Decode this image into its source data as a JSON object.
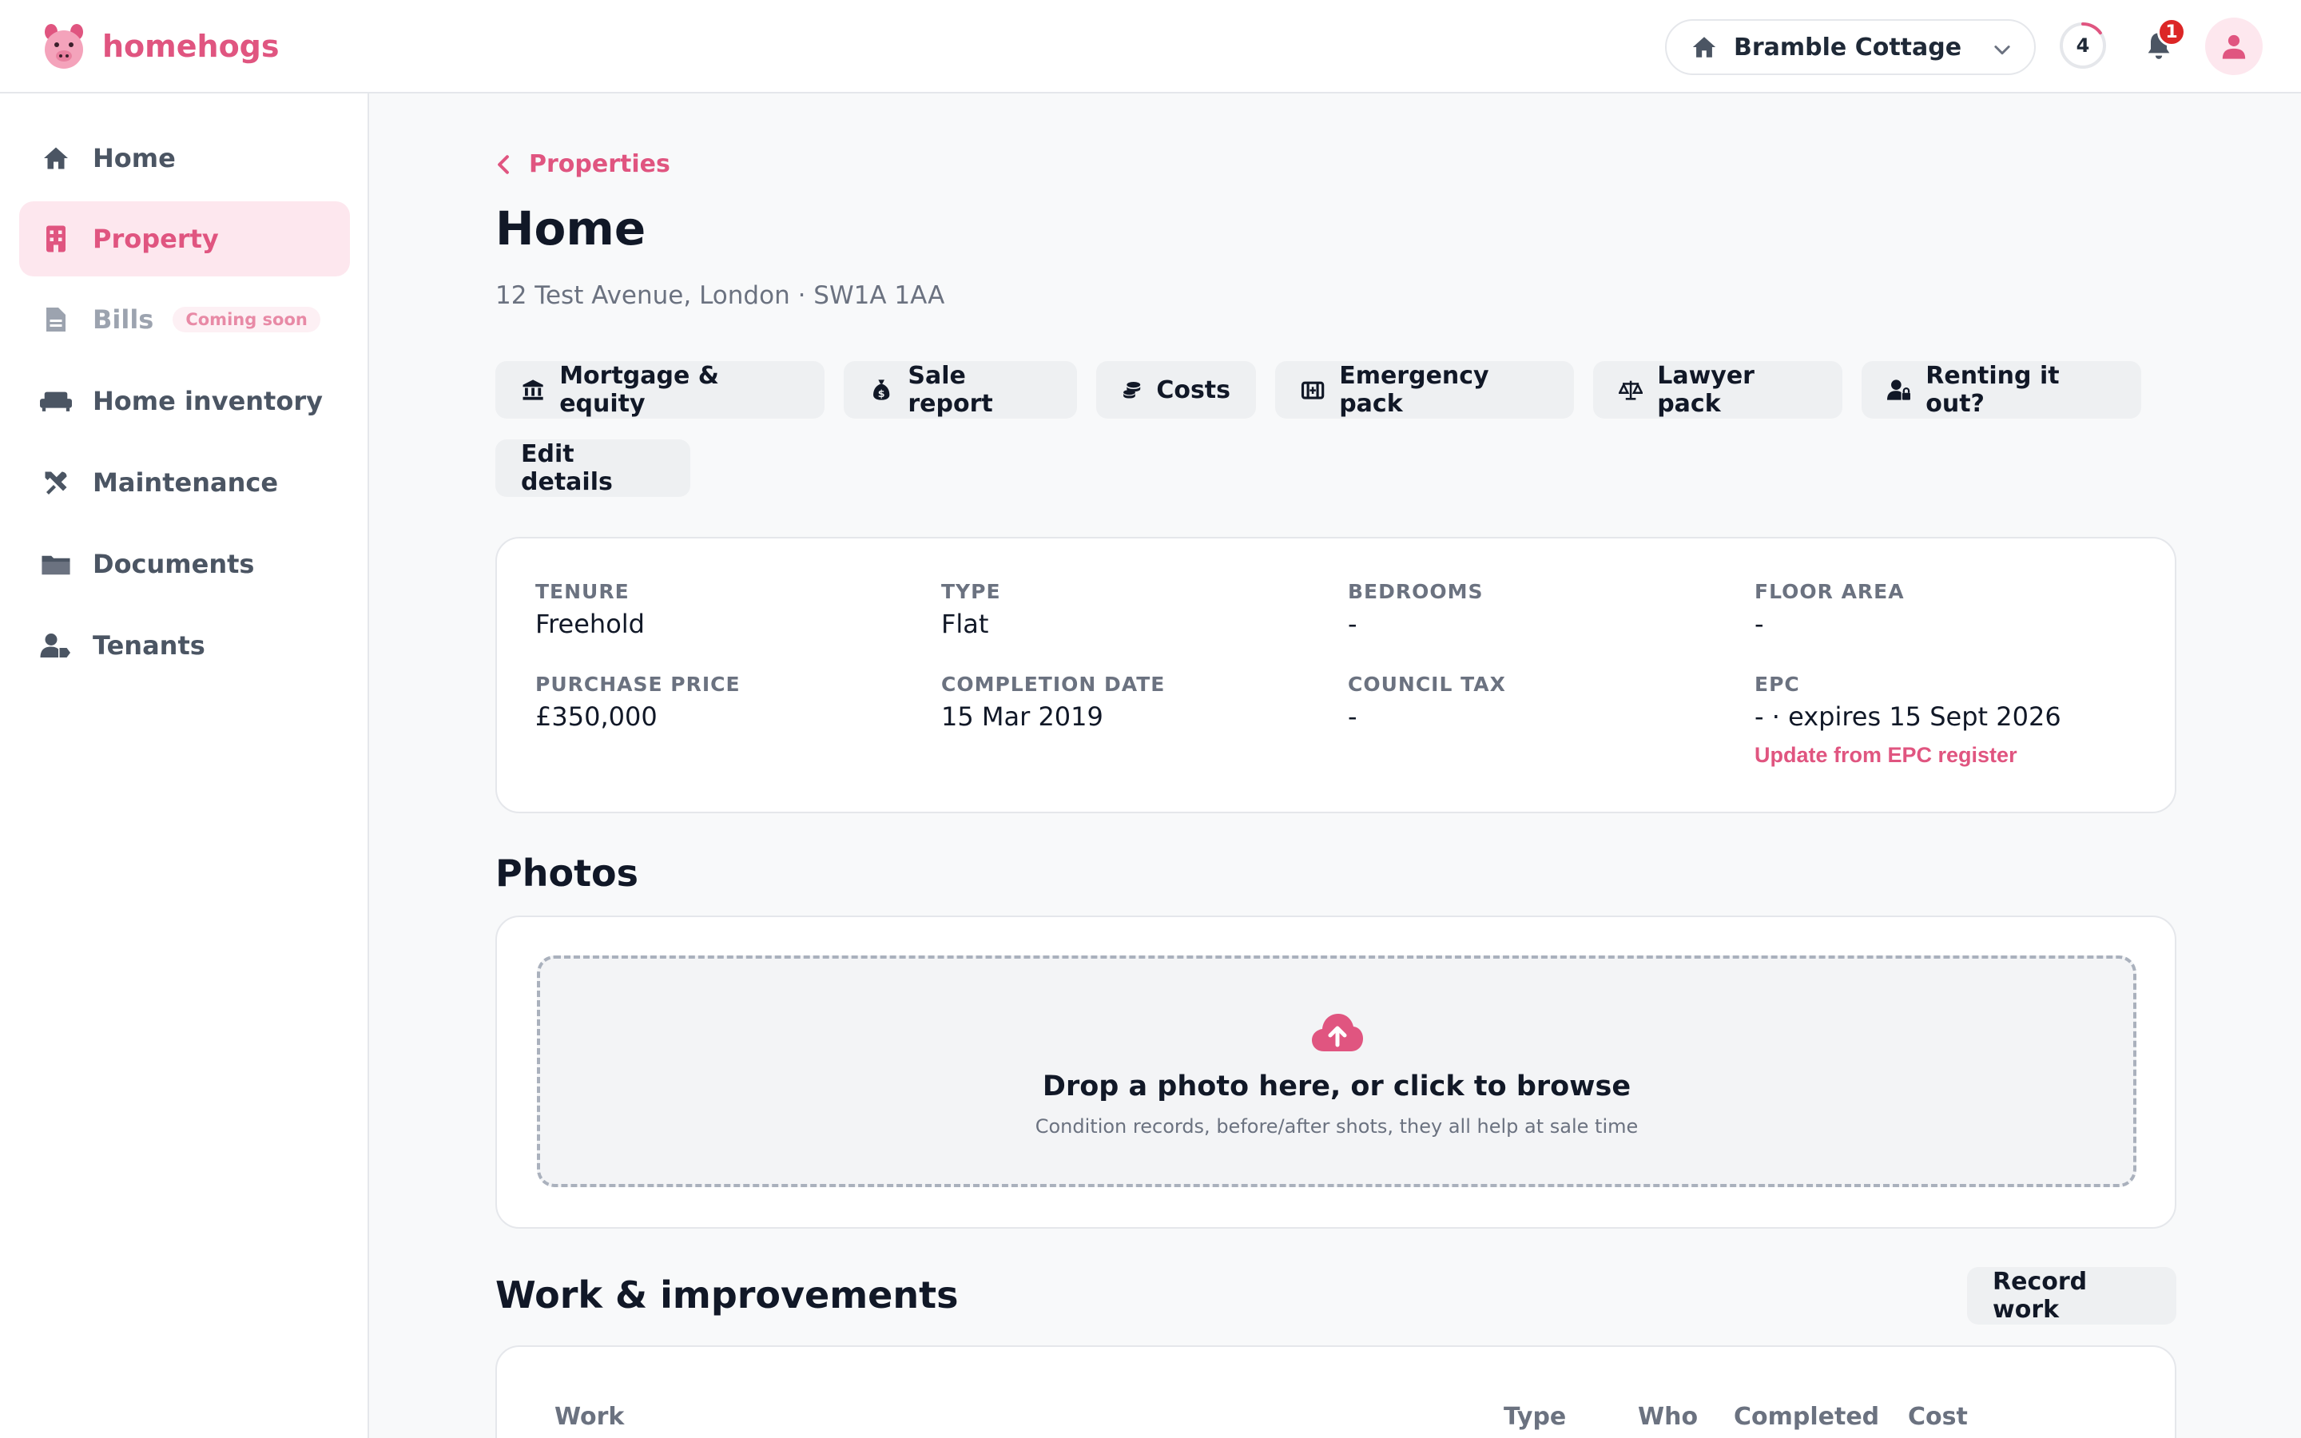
{
  "app": {
    "name": "homehogs"
  },
  "header": {
    "property_selector": "Bramble Cottage",
    "progress_count": "4",
    "progress_fraction": 0.15,
    "notifications_count": "1"
  },
  "sidebar": {
    "items": [
      {
        "label": "Home",
        "icon": "home-icon"
      },
      {
        "label": "Property",
        "icon": "building-icon",
        "active": true
      },
      {
        "label": "Bills",
        "icon": "document-icon",
        "badge": "Coming soon",
        "disabled": true
      },
      {
        "label": "Home inventory",
        "icon": "couch-icon"
      },
      {
        "label": "Maintenance",
        "icon": "tools-icon"
      },
      {
        "label": "Documents",
        "icon": "folder-icon"
      },
      {
        "label": "Tenants",
        "icon": "user-tag-icon"
      }
    ]
  },
  "main": {
    "breadcrumb": "Properties",
    "title": "Home",
    "address": "12 Test Avenue, London · SW1A 1AA",
    "actions": [
      {
        "label": "Mortgage & equity",
        "icon": "bank-icon"
      },
      {
        "label": "Sale report",
        "icon": "money-bag-icon"
      },
      {
        "label": "Costs",
        "icon": "coins-icon"
      },
      {
        "label": "Emergency pack",
        "icon": "first-aid-icon"
      },
      {
        "label": "Lawyer pack",
        "icon": "scales-icon"
      },
      {
        "label": "Renting it out?",
        "icon": "user-lock-icon"
      }
    ],
    "edit_label": "Edit details",
    "details": {
      "tenure": {
        "label": "TENURE",
        "value": "Freehold"
      },
      "type": {
        "label": "TYPE",
        "value": "Flat"
      },
      "bedrooms": {
        "label": "BEDROOMS",
        "value": "-"
      },
      "floor_area": {
        "label": "FLOOR AREA",
        "value": "-"
      },
      "purchase_price": {
        "label": "PURCHASE PRICE",
        "value": "£350,000"
      },
      "completion_date": {
        "label": "COMPLETION DATE",
        "value": "15 Mar 2019"
      },
      "council_tax": {
        "label": "COUNCIL TAX",
        "value": "-"
      },
      "epc": {
        "label": "EPC",
        "value": "- · expires 15 Sept 2026",
        "link": "Update from EPC register"
      }
    },
    "photos": {
      "title": "Photos",
      "drop_title": "Drop a photo here, or click to browse",
      "drop_subtitle": "Condition records, before/after shots, they all help at sale time"
    },
    "work": {
      "title": "Work & improvements",
      "record_label": "Record work",
      "columns": [
        "Work",
        "Type",
        "Who",
        "Completed",
        "Cost"
      ]
    }
  },
  "colors": {
    "accent": "#e05580",
    "accent_light": "#fde7ee",
    "badge": "#dc2626"
  }
}
